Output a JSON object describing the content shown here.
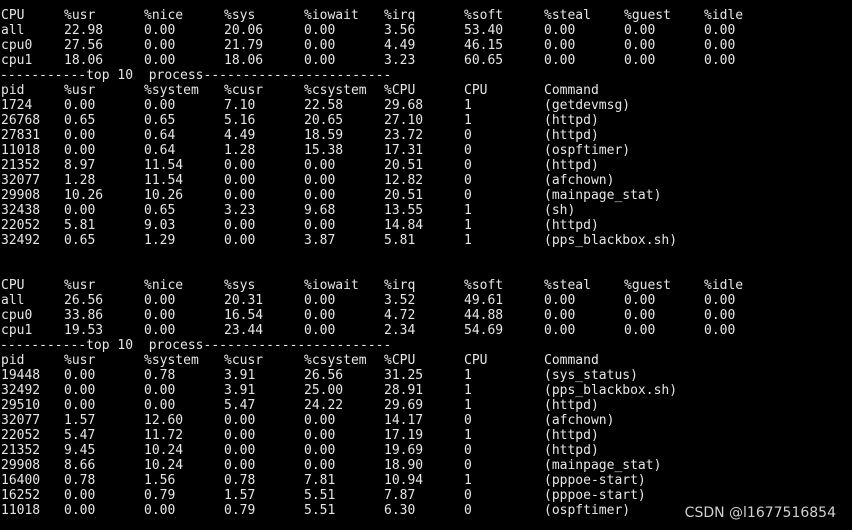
{
  "colors": {
    "background": "#000000",
    "text": "#e6e6e6"
  },
  "samples": [
    {
      "cpu_header": [
        "CPU",
        "%usr",
        "%nice",
        "%sys",
        "%iowait",
        "%irq",
        "%soft",
        "%steal",
        "%guest",
        "%idle"
      ],
      "cpu_rows": [
        [
          "all",
          "22.98",
          "0.00",
          "20.06",
          "0.00",
          "3.56",
          "53.40",
          "0.00",
          "0.00",
          "0.00"
        ],
        [
          "cpu0",
          "27.56",
          "0.00",
          "21.79",
          "0.00",
          "4.49",
          "46.15",
          "0.00",
          "0.00",
          "0.00"
        ],
        [
          "cpu1",
          "18.06",
          "0.00",
          "18.06",
          "0.00",
          "3.23",
          "60.65",
          "0.00",
          "0.00",
          "0.00"
        ]
      ],
      "separator": "-----------top 10  process------------------------",
      "proc_header": [
        "pid",
        "%usr",
        "%system",
        "%cusr",
        "%csystem",
        "%CPU",
        "CPU",
        "Command"
      ],
      "proc_rows": [
        [
          "1724",
          "0.00",
          "0.00",
          "7.10",
          "22.58",
          "29.68",
          "1",
          "(getdevmsg)"
        ],
        [
          "26768",
          "0.65",
          "0.65",
          "5.16",
          "20.65",
          "27.10",
          "1",
          "(httpd)"
        ],
        [
          "27831",
          "0.00",
          "0.64",
          "4.49",
          "18.59",
          "23.72",
          "0",
          "(httpd)"
        ],
        [
          "11018",
          "0.00",
          "0.64",
          "1.28",
          "15.38",
          "17.31",
          "0",
          "(ospftimer)"
        ],
        [
          "21352",
          "8.97",
          "11.54",
          "0.00",
          "0.00",
          "20.51",
          "0",
          "(httpd)"
        ],
        [
          "32077",
          "1.28",
          "11.54",
          "0.00",
          "0.00",
          "12.82",
          "0",
          "(afchown)"
        ],
        [
          "29908",
          "10.26",
          "10.26",
          "0.00",
          "0.00",
          "20.51",
          "0",
          "(mainpage_stat)"
        ],
        [
          "32438",
          "0.00",
          "0.65",
          "3.23",
          "9.68",
          "13.55",
          "1",
          "(sh)"
        ],
        [
          "22052",
          "5.81",
          "9.03",
          "0.00",
          "0.00",
          "14.84",
          "1",
          "(httpd)"
        ],
        [
          "32492",
          "0.65",
          "1.29",
          "0.00",
          "3.87",
          "5.81",
          "1",
          "(pps_blackbox.sh)"
        ]
      ]
    },
    {
      "cpu_header": [
        "CPU",
        "%usr",
        "%nice",
        "%sys",
        "%iowait",
        "%irq",
        "%soft",
        "%steal",
        "%guest",
        "%idle"
      ],
      "cpu_rows": [
        [
          "all",
          "26.56",
          "0.00",
          "20.31",
          "0.00",
          "3.52",
          "49.61",
          "0.00",
          "0.00",
          "0.00"
        ],
        [
          "cpu0",
          "33.86",
          "0.00",
          "16.54",
          "0.00",
          "4.72",
          "44.88",
          "0.00",
          "0.00",
          "0.00"
        ],
        [
          "cpu1",
          "19.53",
          "0.00",
          "23.44",
          "0.00",
          "2.34",
          "54.69",
          "0.00",
          "0.00",
          "0.00"
        ]
      ],
      "separator": "-----------top 10  process------------------------",
      "proc_header": [
        "pid",
        "%usr",
        "%system",
        "%cusr",
        "%csystem",
        "%CPU",
        "CPU",
        "Command"
      ],
      "proc_rows": [
        [
          "19448",
          "0.00",
          "0.78",
          "3.91",
          "26.56",
          "31.25",
          "1",
          "(sys_status)"
        ],
        [
          "32492",
          "0.00",
          "0.00",
          "3.91",
          "25.00",
          "28.91",
          "1",
          "(pps_blackbox.sh)"
        ],
        [
          "29510",
          "0.00",
          "0.00",
          "5.47",
          "24.22",
          "29.69",
          "1",
          "(httpd)"
        ],
        [
          "32077",
          "1.57",
          "12.60",
          "0.00",
          "0.00",
          "14.17",
          "0",
          "(afchown)"
        ],
        [
          "22052",
          "5.47",
          "11.72",
          "0.00",
          "0.00",
          "17.19",
          "1",
          "(httpd)"
        ],
        [
          "21352",
          "9.45",
          "10.24",
          "0.00",
          "0.00",
          "19.69",
          "0",
          "(httpd)"
        ],
        [
          "29908",
          "8.66",
          "10.24",
          "0.00",
          "0.00",
          "18.90",
          "0",
          "(mainpage_stat)"
        ],
        [
          "16400",
          "0.78",
          "1.56",
          "0.78",
          "7.81",
          "10.94",
          "1",
          "(pppoe-start)"
        ],
        [
          "16252",
          "0.00",
          "0.79",
          "1.57",
          "5.51",
          "7.87",
          "0",
          "(pppoe-start)"
        ],
        [
          "11018",
          "0.00",
          "0.00",
          "0.79",
          "5.51",
          "6.30",
          "0",
          "(ospftimer)"
        ]
      ]
    }
  ],
  "watermark": "CSDN @l1677516854"
}
